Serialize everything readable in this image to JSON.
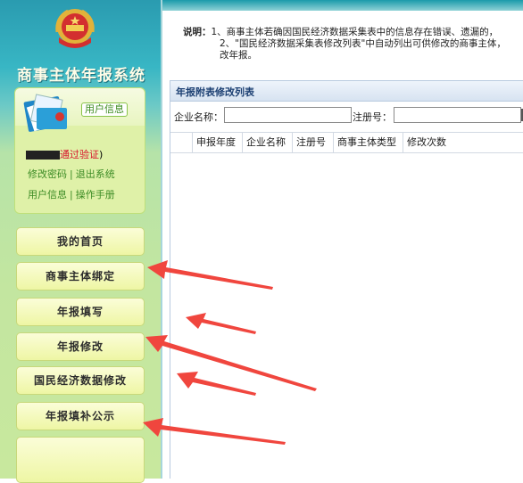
{
  "sidebar": {
    "system_title": "商事主体年报系统",
    "user_panel": {
      "tag_label": "用户信息",
      "verify_status": "通过验证",
      "verify_suffix": ")",
      "links_row1": [
        "修改密码",
        "退出系统"
      ],
      "links_row2": [
        "用户信息",
        "操作手册"
      ]
    },
    "nav_items": [
      {
        "label": "我的首页"
      },
      {
        "label": "商事主体绑定"
      },
      {
        "label": "年报填写"
      },
      {
        "label": "年报修改"
      },
      {
        "label": "国民经济数据修改"
      },
      {
        "label": "年报填补公示"
      },
      {
        "label": ""
      }
    ]
  },
  "main": {
    "note": {
      "label": "说明：",
      "line1": "1、商事主体若确因国民经济数据采集表中的信息存在错误、遗漏的，",
      "line2": "2、\"国民经济数据采集表修改列表\"中自动列出可供修改的商事主体，",
      "line3": "改年报。"
    },
    "list": {
      "title": "年报附表修改列表",
      "filters": {
        "company_label": "企业名称：",
        "company_value": "",
        "reg_label": "注册号：",
        "reg_value": ""
      },
      "columns": [
        "申报年度",
        "企业名称",
        "注册号",
        "商事主体类型",
        "修改次数"
      ],
      "rows": []
    }
  },
  "colors": {
    "sidebar_top": "#2a9bb0",
    "sidebar_bottom": "#c8e89e",
    "nav_button": "#eef6a4",
    "list_title": "#1b3f72",
    "annotation_arrow": "#f0463e",
    "verify_text": "#d8132b"
  }
}
